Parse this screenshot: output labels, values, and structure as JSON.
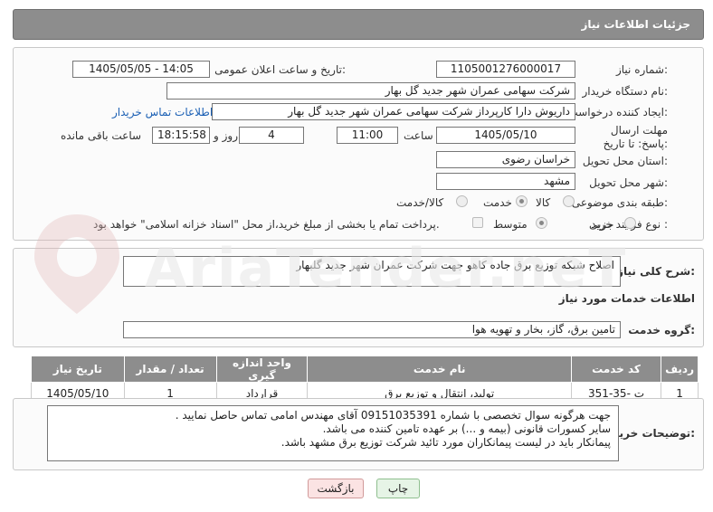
{
  "header": {
    "title": "جزئیات اطلاعات نیاز"
  },
  "fields": {
    "need_number_label": "شماره نیاز:",
    "need_number": "1105001276000017",
    "announce_label": "تاریخ و ساعت اعلان عمومی:",
    "announce_value": "1405/05/05 - 14:05",
    "buyer_label": "نام دستگاه خریدار:",
    "buyer_value": "شرکت سهامی عمران شهر جدید گل بهار",
    "creator_label": "ایجاد کننده درخواست:",
    "creator_value": "داریوش دارا کارپرداز شرکت سهامی عمران شهر جدید گل بهار",
    "contact_link": "اطلاعات تماس خریدار",
    "deadline_label": "مهلت ارسال پاسخ: تا تاریخ:",
    "deadline_date": "1405/05/10",
    "time_label": "ساعت",
    "deadline_time": "11:00",
    "days_value": "4",
    "days_label": "روز و",
    "remaining_time": "18:15:58",
    "remaining_label": "ساعت باقی مانده",
    "province_label": "استان محل تحویل:",
    "province_value": "خراسان رضوی",
    "city_label": "شهر محل تحویل:",
    "city_value": "مشهد",
    "category_label": "طبقه بندی موضوعی:",
    "category_options": [
      "کالا",
      "خدمت",
      "کالا/خدمت"
    ],
    "process_label": "نوع فرآیند خرید :",
    "process_options": [
      "جزیی",
      "متوسط"
    ],
    "payment_note": "پرداخت تمام یا بخشی از مبلغ خرید،از محل \"اسناد خزانه اسلامی\" خواهد بود."
  },
  "summary": {
    "label": "شرح کلی نیاز:",
    "value": "اصلاح شبکه توزیع برق جاده کاهو جهت شرکت عمران شهر جدید گلبهار"
  },
  "services": {
    "section_title": "اطلاعات خدمات مورد نیاز",
    "group_label": "گروه خدمت:",
    "group_value": "تامین برق، گاز، بخار و تهویه هوا",
    "columns": [
      "ردیف",
      "کد خدمت",
      "نام خدمت",
      "واحد اندازه گیری",
      "تعداد / مقدار",
      "تاریخ نیاز"
    ],
    "rows": [
      {
        "row": "1",
        "code": "ت -35-351",
        "name": "تولید، انتقال و توزیع برق",
        "unit": "قرارداد",
        "qty": "1",
        "date": "1405/05/10"
      }
    ]
  },
  "notes": {
    "label": "توضیحات خریدار:",
    "lines": [
      "جهت هرگونه سوال تخصصی با شماره 09151035391 آقای مهندس امامی تماس حاصل نمایید .",
      "سایر کسورات قانونی (بیمه و ...) بر عهده تامین کننده می باشد.",
      "پیمانکار باید در لیست پیمانکاران مورد تائید شرکت توزیع برق مشهد باشد."
    ]
  },
  "buttons": {
    "print": "چاپ",
    "back": "بازگشت"
  },
  "watermark": "AriaTender.neT"
}
